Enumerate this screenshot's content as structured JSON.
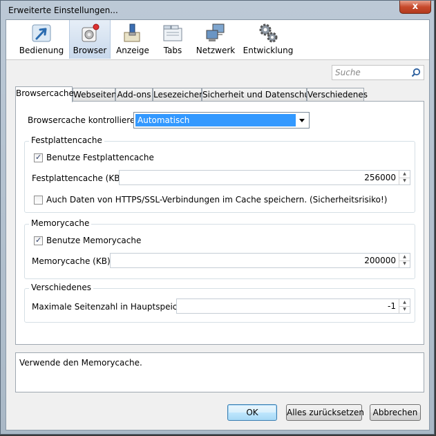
{
  "window": {
    "title": "Erweiterte Einstellungen...",
    "close_label": "x"
  },
  "toolbar": {
    "items": [
      {
        "label": "Bedienung",
        "icon": "cursor-arrow-icon"
      },
      {
        "label": "Browser",
        "icon": "browser-gear-icon",
        "selected": true
      },
      {
        "label": "Anzeige",
        "icon": "paintbrush-icon"
      },
      {
        "label": "Tabs",
        "icon": "tabs-icon"
      },
      {
        "label": "Netzwerk",
        "icon": "network-computers-icon"
      },
      {
        "label": "Entwicklung",
        "icon": "gears-icon"
      }
    ]
  },
  "search": {
    "placeholder": "Suche",
    "icon": "search-icon"
  },
  "tabs": [
    "Browsercache",
    "Webseiten",
    "Add-ons",
    "Lesezeichen",
    "Sicherheit und Datenschutz",
    "Verschiedenes"
  ],
  "active_tab": "Browsercache",
  "browsercache": {
    "control_label": "Browsercache kontrollieren",
    "control_value": "Automatisch",
    "disk": {
      "legend": "Festplattencache",
      "use_label": "Benutze Festplattencache",
      "use_checked": true,
      "size_label": "Festplattencache (KB):",
      "size_value": "256000",
      "ssl_label": "Auch Daten von HTTPS/SSL-Verbindungen im Cache speichern. (Sicherheitsrisiko!)",
      "ssl_checked": false
    },
    "memory": {
      "legend": "Memorycache",
      "use_label": "Benutze Memorycache",
      "use_checked": true,
      "size_label": "Memorycache (KB):",
      "size_value": "200000"
    },
    "misc": {
      "legend": "Verschiedenes",
      "pages_label": "Maximale Seitenzahl in Hauptspeicher",
      "pages_value": "-1"
    }
  },
  "info_text": "Verwende den Memorycache.",
  "buttons": {
    "ok": "OK",
    "reset": "Alles zurücksetzen",
    "cancel": "Abbrechen"
  },
  "colors": {
    "selection": "#3399ff",
    "close": "#c74a2c",
    "titlebar": "#bcc9d6"
  }
}
